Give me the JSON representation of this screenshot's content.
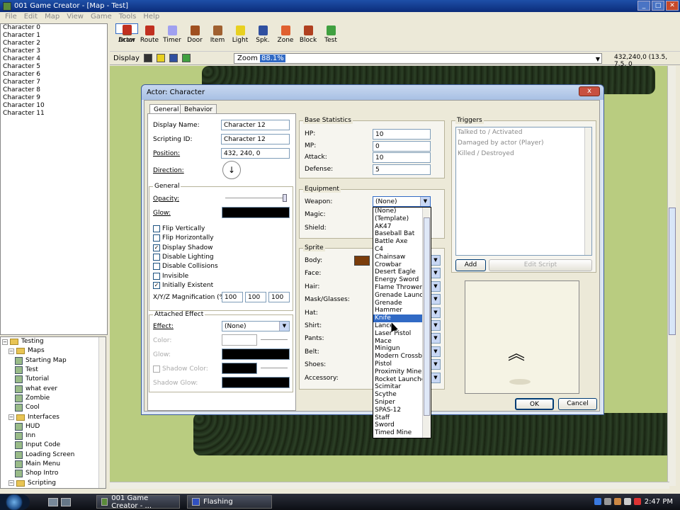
{
  "window": {
    "title": "001 Game Creator - [Map - Test]"
  },
  "menu": [
    "File",
    "Edit",
    "Map",
    "View",
    "Game",
    "Tools",
    "Help"
  ],
  "characters": [
    "Character 0",
    "Character 1",
    "Character 2",
    "Character 3",
    "Character 4",
    "Character 5",
    "Character 6",
    "Character 7",
    "Character 8",
    "Character 9",
    "Character 10",
    "Character 11"
  ],
  "tree": [
    {
      "label": "Testing",
      "level": 0,
      "kind": "folder"
    },
    {
      "label": "Maps",
      "level": 1,
      "kind": "folder"
    },
    {
      "label": "Starting Map",
      "level": 2,
      "kind": "map"
    },
    {
      "label": "Test",
      "level": 2,
      "kind": "map"
    },
    {
      "label": "Tutorial",
      "level": 2,
      "kind": "map"
    },
    {
      "label": "what ever",
      "level": 2,
      "kind": "map"
    },
    {
      "label": "Zombie",
      "level": 2,
      "kind": "map"
    },
    {
      "label": "Cool",
      "level": 2,
      "kind": "map"
    },
    {
      "label": "Interfaces",
      "level": 1,
      "kind": "folder"
    },
    {
      "label": "HUD",
      "level": 2,
      "kind": "map"
    },
    {
      "label": "Inn",
      "level": 2,
      "kind": "map"
    },
    {
      "label": "Input Code",
      "level": 2,
      "kind": "map"
    },
    {
      "label": "Loading Screen",
      "level": 2,
      "kind": "map"
    },
    {
      "label": "Main Menu",
      "level": 2,
      "kind": "map"
    },
    {
      "label": "Shop Intro",
      "level": 2,
      "kind": "map"
    },
    {
      "label": "Scripting",
      "level": 1,
      "kind": "folder"
    }
  ],
  "tools": [
    {
      "label": "Draw",
      "color": "#7a5a3a"
    },
    {
      "label": "Actor",
      "color": "#c03020"
    },
    {
      "label": "Route",
      "color": "#c03020"
    },
    {
      "label": "Timer",
      "color": "#a0a0f0"
    },
    {
      "label": "Door",
      "color": "#a05020"
    },
    {
      "label": "Item",
      "color": "#a06030"
    },
    {
      "label": "Light",
      "color": "#e8d020"
    },
    {
      "label": "Spk.",
      "color": "#3050a0"
    },
    {
      "label": "Zone",
      "color": "#e06030"
    },
    {
      "label": "Block",
      "color": "#b04020"
    },
    {
      "label": "Test",
      "color": "#40a040"
    }
  ],
  "displaybar": {
    "label": "Display",
    "zoom_label": "Zoom",
    "zoom_value": "88.1%",
    "coords": "432,240,0 (13.5, 7.5, 0"
  },
  "dialog": {
    "title": "Actor: Character",
    "close": "x",
    "tabs": [
      "General",
      "Behavior"
    ],
    "display_name_label": "Display Name:",
    "display_name": "Character 12",
    "scripting_id_label": "Scripting ID:",
    "scripting_id": "Character 12",
    "position_label": "Position:",
    "position": "432, 240, 0",
    "direction_label": "Direction:",
    "general_group": "General",
    "opacity_label": "Opacity:",
    "glow_label": "Glow:",
    "checkboxes": [
      {
        "label": "Flip Vertically",
        "checked": false
      },
      {
        "label": "Flip Horizontally",
        "checked": false
      },
      {
        "label": "Display Shadow",
        "checked": true
      },
      {
        "label": "Disable Lighting",
        "checked": false
      },
      {
        "label": "Disable Collisions",
        "checked": false
      },
      {
        "label": "Invisible",
        "checked": false
      },
      {
        "label": "Initially Existent",
        "checked": true
      }
    ],
    "magnification_label": "X/Y/Z Magnification (%):",
    "magnification": [
      "100",
      "100",
      "100"
    ],
    "attached_group": "Attached Effect",
    "effect_label": "Effect:",
    "effect_value": "(None)",
    "color_label": "Color:",
    "glow2_label": "Glow:",
    "shadow_color_label": "Shadow Color:",
    "shadow_glow_label": "Shadow Glow:",
    "base_stats_group": "Base Statistics",
    "stats": [
      {
        "label": "HP:",
        "value": "10"
      },
      {
        "label": "MP:",
        "value": "0"
      },
      {
        "label": "Attack:",
        "value": "10"
      },
      {
        "label": "Defense:",
        "value": "5"
      }
    ],
    "equipment_group": "Equipment",
    "weapon_label": "Weapon:",
    "weapon_value": "(None)",
    "magic_label": "Magic:",
    "shield_label": "Shield:",
    "sprite_group": "Sprite",
    "sprite_labels": [
      "Body:",
      "Face:",
      "Hair:",
      "Mask/Glasses:",
      "Hat:",
      "Shirt:",
      "Pants:",
      "Belt:",
      "Shoes:",
      "Accessory:"
    ],
    "triggers_group": "Triggers",
    "triggers": [
      "Talked to / Activated",
      "Damaged by actor (Player)",
      "Killed / Destroyed"
    ],
    "add_btn": "Add",
    "edit_script_btn": "Edit Script",
    "ok_btn": "OK",
    "cancel_btn": "Cancel"
  },
  "weapon_options": [
    "(None)",
    "(Template)",
    "AK47",
    "Baseball Bat",
    "Battle Axe",
    "C4",
    "Chainsaw",
    "Crowbar",
    "Desert Eagle",
    "Energy Sword",
    "Flame Thrower",
    "Grenade Launcher",
    "Grenade",
    "Hammer",
    "Knife",
    "Lance",
    "Laser Pistol",
    "Mace",
    "Minigun",
    "Modern Crossbow",
    "Pistol",
    "Proximity Mine",
    "Rocket Launcher",
    "Scimitar",
    "Scythe",
    "Sniper",
    "SPAS-12",
    "Staff",
    "Sword",
    "Timed Mine"
  ],
  "weapon_highlight": "Knife",
  "taskbar": {
    "items": [
      "001 Game Creator - ...",
      "Flashing"
    ],
    "clock": "2:47 PM"
  }
}
